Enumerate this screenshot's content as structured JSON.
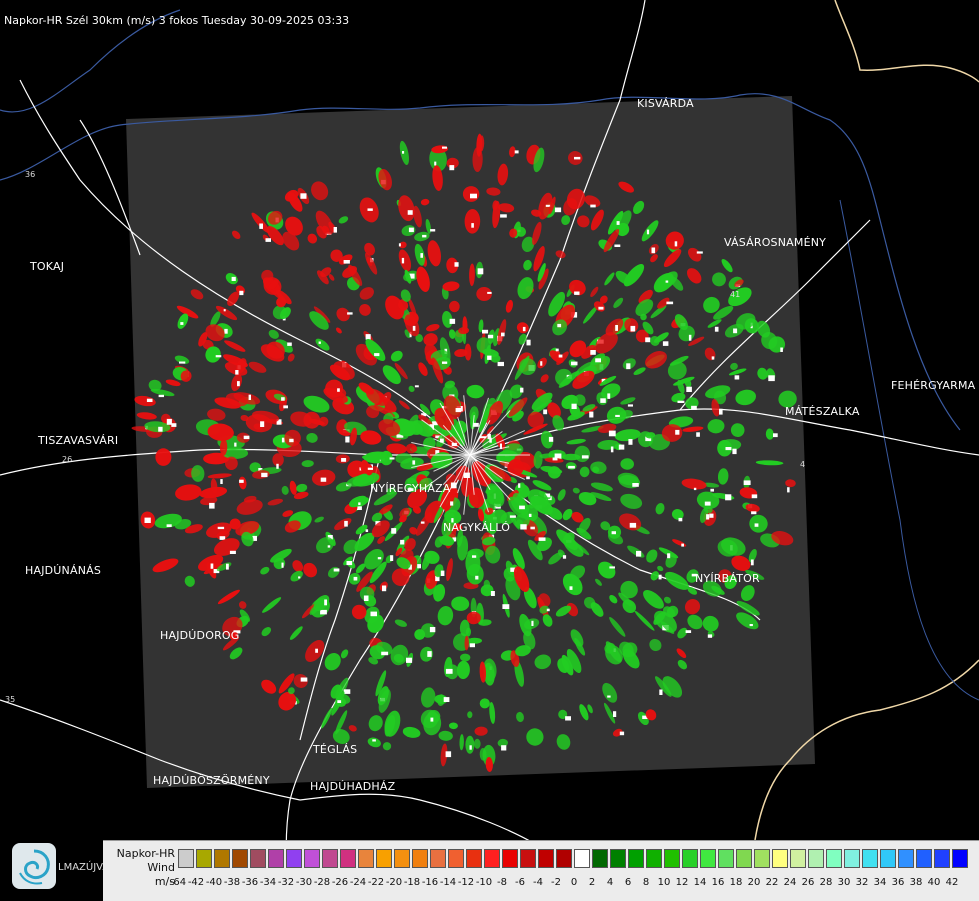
{
  "header": {
    "title": "Napkor-HR Szél 30km (m/s) 3 fokos Tuesday 30-09-2025 03:33"
  },
  "map": {
    "cities": [
      {
        "name": "TOKAJ"
      },
      {
        "name": "KISVÁRDA"
      },
      {
        "name": "VÁSÁROSNAMÉNY"
      },
      {
        "name": "FEHÉRGYARMA"
      },
      {
        "name": "MÁTÉSZALKA"
      },
      {
        "name": "TISZAVASVÁRI"
      },
      {
        "name": "NYÍREGYHÁZA"
      },
      {
        "name": "NAGYKÁLLÓ"
      },
      {
        "name": "NYÍRBÁTOR"
      },
      {
        "name": "HAJDÚNÁNÁS"
      },
      {
        "name": "HAJDÚDOROG"
      },
      {
        "name": "TÉGLÁS"
      },
      {
        "name": "HAJDÚBÖSZÖRMÉNY"
      },
      {
        "name": "HAJDÚHADHÁZ"
      }
    ],
    "road_numbers": [
      "36",
      "35",
      "41",
      "26",
      "4"
    ],
    "colors": {
      "background": "#000000",
      "radar_area": "#333333",
      "negative_wind": "#e81010",
      "positive_wind": "#22cc22",
      "roads": "#ffffff",
      "rivers": "#3a5aa0",
      "border": "#f0d8a8"
    }
  },
  "legend": {
    "product": "Napkor-HR",
    "quantity": "Wind",
    "unit": "m/s",
    "logo_text": "LMAZÚJVÁR",
    "colors": [
      "#cccccc",
      "#a8a800",
      "#b07800",
      "#a04800",
      "#a04c60",
      "#b040a8",
      "#9040f0",
      "#c050d8",
      "#c04890",
      "#d03080",
      "#e8843c",
      "#f8a000",
      "#f49010",
      "#f08010",
      "#e87040",
      "#f06030",
      "#e83010",
      "#ff2020",
      "#e80000",
      "#c81010",
      "#c00000",
      "#b00000",
      "#ffffff",
      "#006800",
      "#008000",
      "#00a000",
      "#10b000",
      "#20c000",
      "#28d028",
      "#40e840",
      "#60e060",
      "#80d850",
      "#a0e060",
      "#ffff80",
      "#d0f0a0",
      "#b0f0b0",
      "#80ffc0",
      "#80f0e0",
      "#40e0f0",
      "#30c8f8",
      "#3090ff",
      "#2060ff",
      "#2040ff",
      "#0000ff"
    ],
    "ticks": [
      "-64",
      "-42",
      "-40",
      "-38",
      "-36",
      "-34",
      "-32",
      "-30",
      "-28",
      "-26",
      "-24",
      "-22",
      "-20",
      "-18",
      "-16",
      "-14",
      "-12",
      "-10",
      "-8",
      "-6",
      "-4",
      "-2",
      "0",
      "2",
      "4",
      "6",
      "8",
      "10",
      "12",
      "14",
      "16",
      "18",
      "20",
      "22",
      "24",
      "26",
      "28",
      "30",
      "32",
      "34",
      "36",
      "38",
      "40",
      "42"
    ]
  }
}
